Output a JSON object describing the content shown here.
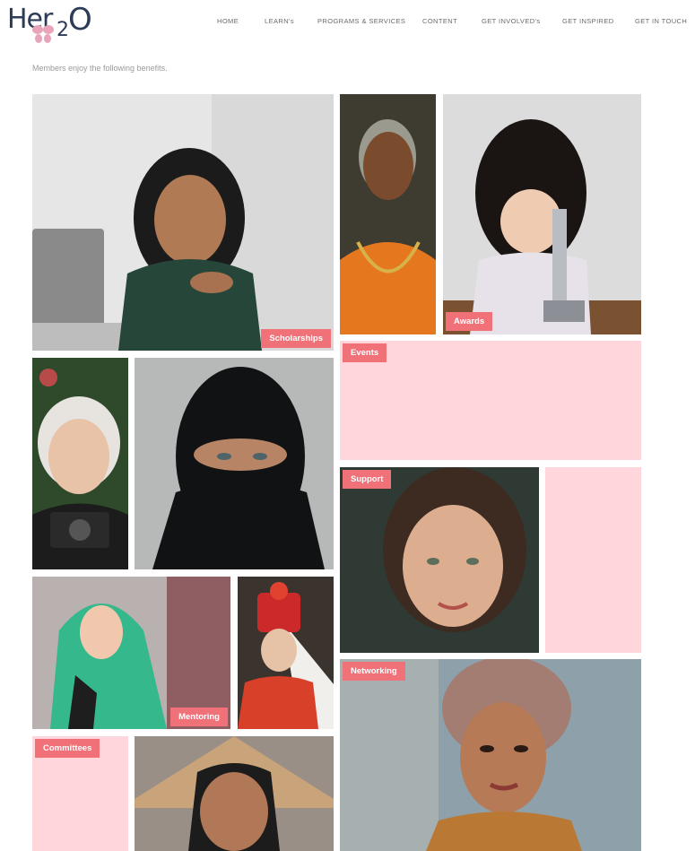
{
  "header": {
    "logo": {
      "part1": "Her",
      "part2": "2",
      "part3": "O"
    },
    "nav": [
      "HOME",
      "LEARN's",
      "PROGRAMS & SERVICES",
      "CONTENT",
      "GET INVOLVED's",
      "GET INSPIRED",
      "GET IN TOUCH"
    ]
  },
  "main": {
    "intro": "Members enjoy the following benefits.",
    "benefits": {
      "scholarships": "Scholarships",
      "awards": "Awards",
      "events": "Events",
      "support": "Support",
      "mentoring": "Mentoring",
      "networking": "Networking",
      "committees": "Committees"
    }
  },
  "colors": {
    "accent": "#f07178",
    "pink_tile": "#ffd6db",
    "logo": "#2c3b57"
  }
}
